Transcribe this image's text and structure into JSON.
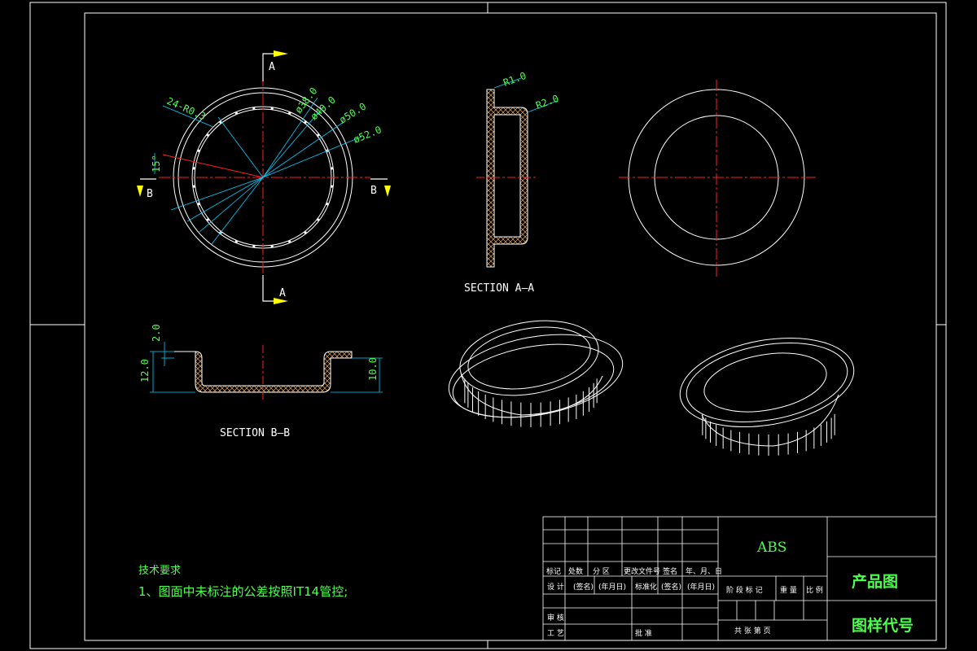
{
  "colors": {
    "background": "#000000",
    "outline": "#ffffff",
    "centerline": "#ff2020",
    "dimension": "#00ffff",
    "dimension_text": "#4dff4d",
    "section_marker": "#ffff00",
    "title_block_text": "#4dff4d"
  },
  "section_markers": {
    "a": "A",
    "b": "B"
  },
  "plan_view": {
    "dims": {
      "slots": "24-R0.3",
      "angle": "15°",
      "d1": "ø38.0",
      "d2": "ø40.0",
      "d3": "ø50.0",
      "d4": "ø52.0"
    }
  },
  "section_a": {
    "title": "SECTION A—A",
    "r1": "R1.0",
    "r2": "R2.0"
  },
  "section_b": {
    "title": "SECTION B—B",
    "dim_top": "2.0",
    "dim_left": "12.0",
    "dim_right": "10.0"
  },
  "notes": {
    "heading": "技术要求",
    "line1": "1、图面中未标注的公差按照IT14管控;"
  },
  "title_block": {
    "material": "ABS",
    "product": "产品图",
    "drawing_no": "图样代号",
    "rev_headers": [
      "标记",
      "处数",
      "分 区",
      "更改文件号",
      "签名",
      "年、月、日"
    ],
    "design_row": [
      "设 计",
      "(签名)",
      "(年月日)",
      "标准化",
      "(签名)",
      "(年月日)"
    ],
    "stage_headers": [
      "阶 段 标 记",
      "重 量",
      "比 例"
    ],
    "review": "审 核",
    "process": "工 艺",
    "approve": "批 准",
    "sheets": "共   张   第   页"
  }
}
